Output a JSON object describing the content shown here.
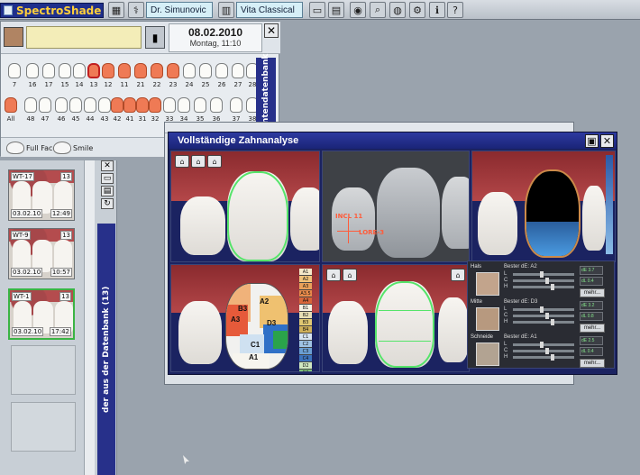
{
  "toolbar": {
    "app_name": "SpectroShade",
    "doctor": "Dr. Simunovic",
    "shade_guide": "Vita Classical"
  },
  "patient": {
    "date": "08.02.2010",
    "datetime": "Montag, 11:10",
    "upper_teeth": [
      "7",
      "16",
      "17",
      "15",
      "14",
      "13",
      "12",
      "11",
      "21",
      "22",
      "23",
      "24",
      "25",
      "26",
      "27",
      "28"
    ],
    "upper_current": "13",
    "lower_teeth": [
      "All",
      "48",
      "47",
      "46",
      "45",
      "44",
      "43",
      "42",
      "41",
      "31",
      "32",
      "33",
      "34",
      "35",
      "36",
      "37",
      "38"
    ],
    "face_buttons": [
      "Full Face",
      "Smile"
    ],
    "side_label": "Patientendatenbank"
  },
  "thumbnails": [
    {
      "tooth_label": "WT-17",
      "num": "13",
      "date": "03.02.10",
      "time": "12:49",
      "active": false
    },
    {
      "tooth_label": "WT-9",
      "num": "13",
      "date": "03.02.10",
      "time": "10:57",
      "active": false
    },
    {
      "tooth_label": "WT-1",
      "num": "13",
      "date": "03.02.10",
      "time": "17:42",
      "active": true
    }
  ],
  "left_strip_label": "der aus der Datenbank (13)",
  "analysis": {
    "title": "Vollständige Zahnanalyse",
    "cross_labels": [
      "INCL 11",
      "LORE-3"
    ],
    "shade_regions": [
      "A2",
      "B3",
      "A3",
      "D3",
      "C1",
      "A1"
    ],
    "legend": [
      "A1",
      "A2",
      "A3",
      "A3.5",
      "A4",
      "B1",
      "B2",
      "B3",
      "B4",
      "C1",
      "C2",
      "C3",
      "C4",
      "D2",
      "D3",
      "D4"
    ],
    "zones": [
      {
        "name": "Hals",
        "best": "Bester dE: A2",
        "de": "dE 3.7",
        "de2": "dL 0.4"
      },
      {
        "name": "Mitte",
        "best": "Bester dE: D3",
        "de": "dE 3.2",
        "de2": "dL 0.8"
      },
      {
        "name": "Schneide",
        "best": "Bester dE: A1",
        "de": "dE 2.5",
        "de2": "dL 0.4"
      }
    ],
    "lch": [
      "L",
      "C",
      "H"
    ],
    "more_label": "mehr..."
  },
  "colors": {
    "accent_navy": "#1b2361",
    "selected_tooth": "#ef7a55",
    "zone_outline": "#55e46a",
    "logo_text": "#ffcf3a"
  }
}
